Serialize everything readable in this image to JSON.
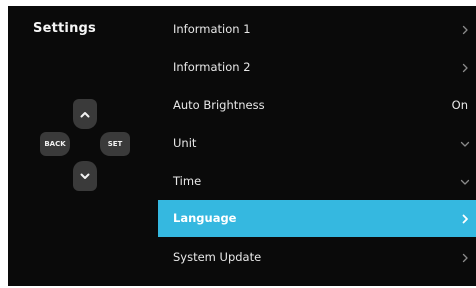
{
  "title": "Settings",
  "controls": {
    "back_label": "BACK",
    "set_label": "SET"
  },
  "menu": [
    {
      "label": "Information 1",
      "indicator": "chevron-right-icon",
      "value": ""
    },
    {
      "label": "Information 2",
      "indicator": "chevron-right-icon",
      "value": ""
    },
    {
      "label": "Auto Brightness",
      "indicator": "none",
      "value": "On"
    },
    {
      "label": "Unit",
      "indicator": "chevron-down-icon",
      "value": ""
    },
    {
      "label": "Time",
      "indicator": "chevron-down-icon",
      "value": ""
    },
    {
      "label": "Language",
      "indicator": "chevron-right-icon",
      "value": "",
      "selected": true
    },
    {
      "label": "System Update",
      "indicator": "chevron-right-icon",
      "value": ""
    }
  ],
  "colors": {
    "background": "#0a0a0a",
    "highlight": "#35b8e0",
    "key": "#3a3a3a"
  }
}
